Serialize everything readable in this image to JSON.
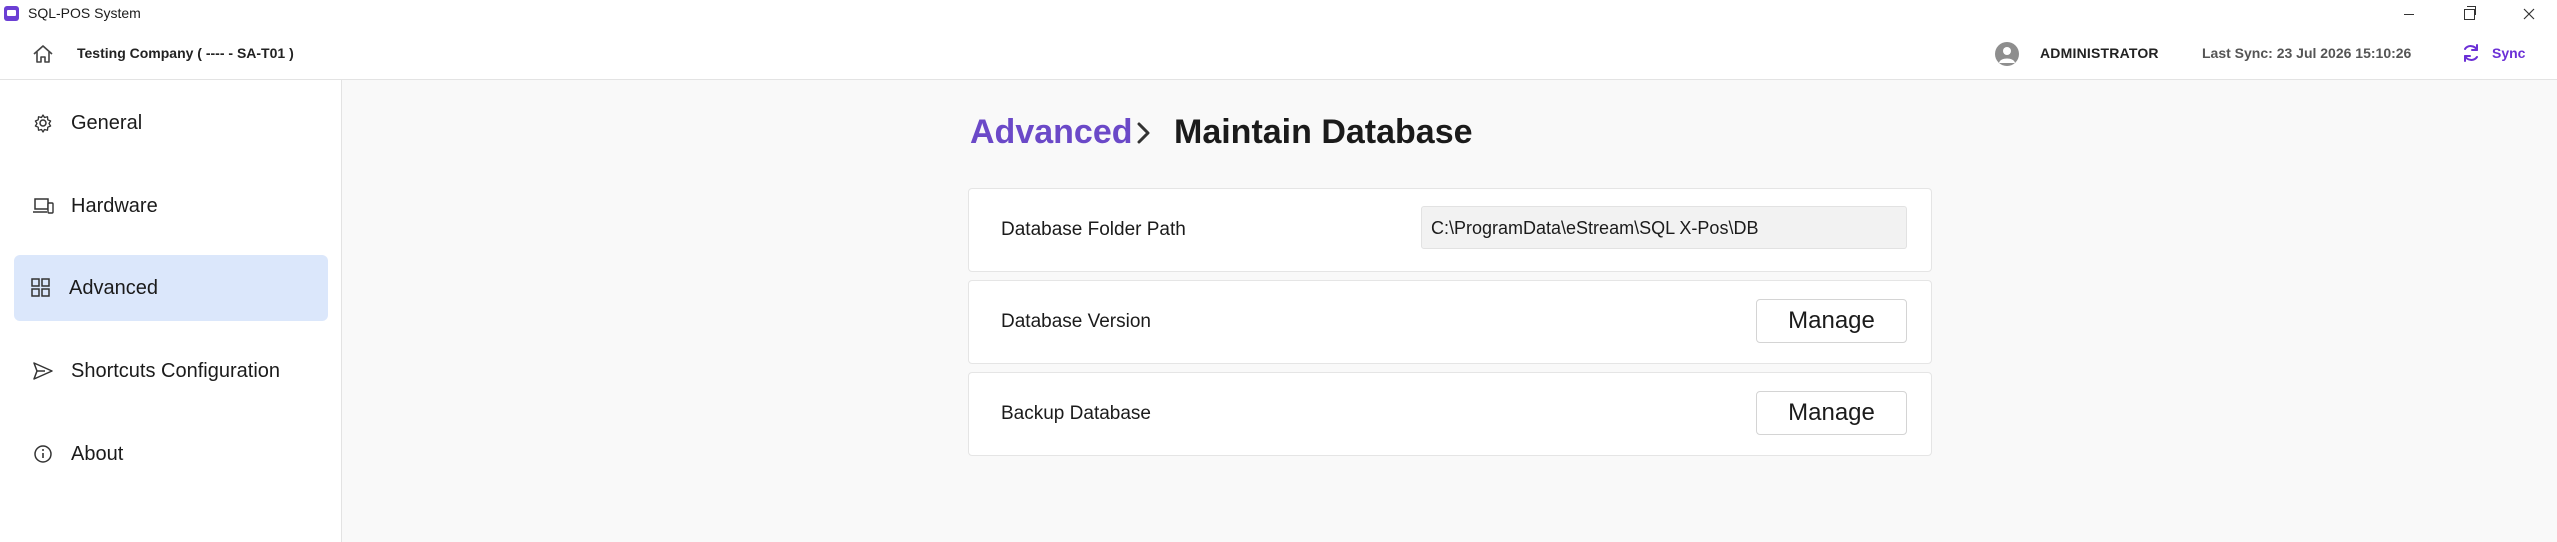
{
  "window": {
    "title": "SQL-POS System",
    "icon": "app-icon"
  },
  "header": {
    "home_icon": "home-icon",
    "company": "Testing Company ( ---- - SA-T01 )",
    "user": "ADMINISTRATOR",
    "last_sync": "Last Sync: 23 Jul 2026 15:10:26",
    "sync_label": "Sync",
    "accent_color": "#6b2fd6"
  },
  "sidebar": {
    "items": [
      {
        "label": "General",
        "icon": "gear-icon",
        "active": false
      },
      {
        "label": "Hardware",
        "icon": "devices-icon",
        "active": false
      },
      {
        "label": "Advanced",
        "icon": "grid-icon",
        "active": true
      },
      {
        "label": "Shortcuts Configuration",
        "icon": "send-icon",
        "active": false
      },
      {
        "label": "About",
        "icon": "info-icon",
        "active": false
      }
    ],
    "active_color": "#dbe7fb"
  },
  "main": {
    "breadcrumb": {
      "parent": "Advanced",
      "current": "Maintain Database",
      "parent_color": "#6b49c8"
    },
    "rows": [
      {
        "label": "Database Folder Path",
        "value": "C:\\ProgramData\\eStream\\SQL X-Pos\\DB"
      },
      {
        "label": "Database Version",
        "button": "Manage"
      },
      {
        "label": "Backup Database",
        "button": "Manage"
      }
    ]
  }
}
